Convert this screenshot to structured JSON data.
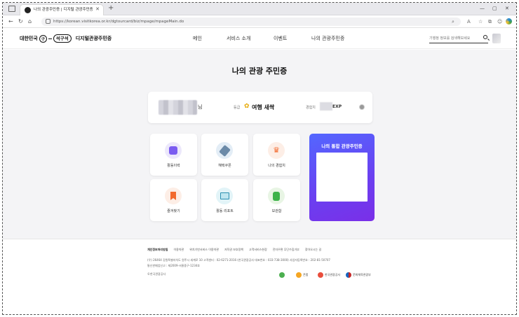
{
  "browser": {
    "tab_title": "나의 관광주민증 | 디지털 관광주민증",
    "url": "https://korean.visitkorea.or.kr/dgtourcard/biz/mpage/mpageMain.do"
  },
  "header": {
    "logo_brand": "대한민국",
    "logo_ring": "구",
    "logo_pill": "석구석",
    "logo_service": "디지털관광주민증",
    "nav": [
      "메인",
      "서비스 소개",
      "이벤트",
      "나의 관광주민증"
    ],
    "search_placeholder": "기행정 정보를 검색해보세요"
  },
  "main": {
    "title": "나의 관광 주민증",
    "profile": {
      "name_suffix": "님",
      "grade_label": "등급",
      "grade_value": "여행 새싹",
      "exp_label": "경험치",
      "exp_unit": "EXP"
    },
    "tiles": [
      {
        "label": "활동이력",
        "icon": "activity-history-icon"
      },
      {
        "label": "혜택쿠폰",
        "icon": "coupon-icon"
      },
      {
        "label": "나의 경험치",
        "icon": "crown-icon"
      },
      {
        "label": "즐겨찾기",
        "icon": "bookmark-icon"
      },
      {
        "label": "활동 리포트",
        "icon": "report-icon"
      },
      {
        "label": "보관함",
        "icon": "storage-icon"
      }
    ],
    "promo_title": "나의 통합 관광주민증"
  },
  "footer": {
    "links": [
      "개인정보처리방침",
      "이용약관",
      "위치기반서비스 이용약관",
      "저작권 보호정책",
      "고객서비스헌장",
      "전자우편 무단수집거부",
      "찾아오시는 길"
    ],
    "address_line": "(우) 26464 강원특별자치도 원주시 세계로 10     고객센터 : 02-6271-2016 (한국관광공사 대표번호 : 033-738-3000)     사업자등록번호 : 202-81-50707",
    "license_line": "통신판매업신고 : 제2009-서울중구-1234호",
    "copyright": "©한국관광공사",
    "partner_logos": [
      "콘랩",
      "한국관광공사",
      "문화체육관광부"
    ]
  },
  "colors": {
    "accent_purple": "#6b3ff0",
    "background": "#f4f4f6"
  }
}
